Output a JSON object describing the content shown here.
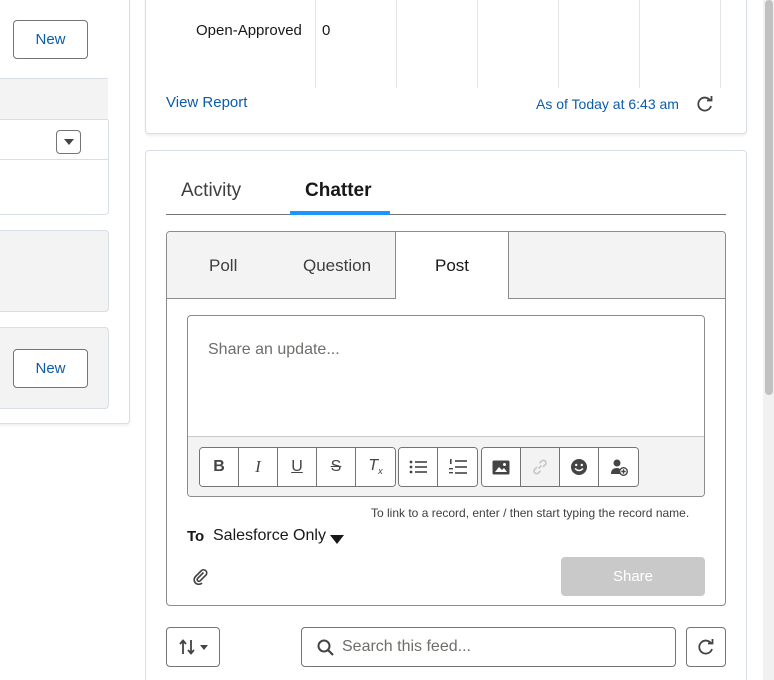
{
  "left_panel": {
    "new_button_1": "New",
    "new_button_2": "New"
  },
  "report": {
    "row_label": "Open-Approved",
    "row_value": "0",
    "view_report": "View Report",
    "as_of": "As of Today at 6:43 am"
  },
  "tabs": {
    "activity": "Activity",
    "chatter": "Chatter",
    "active": "Chatter"
  },
  "publisher": {
    "tabs": [
      "Poll",
      "Question",
      "Post"
    ],
    "active_tab": "Post",
    "placeholder": "Share an update...",
    "hint": "To link to a record, enter / then start typing the record name.",
    "to_label": "To",
    "to_value": "Salesforce Only",
    "share_label": "Share"
  },
  "toolbar": {
    "groups": [
      [
        "bold-icon",
        "italic-icon",
        "underline-icon",
        "strikethrough-icon",
        "clear-format-icon"
      ],
      [
        "bullet-list-icon",
        "numbered-list-icon"
      ],
      [
        "image-icon",
        "link-icon",
        "emoji-icon",
        "mention-icon"
      ]
    ]
  },
  "feed": {
    "search_placeholder": "Search this feed..."
  },
  "colors": {
    "brand_link": "#0b5cab",
    "active_tab_bar": "#1b96ff",
    "share_disabled": "#c9c9c9"
  }
}
